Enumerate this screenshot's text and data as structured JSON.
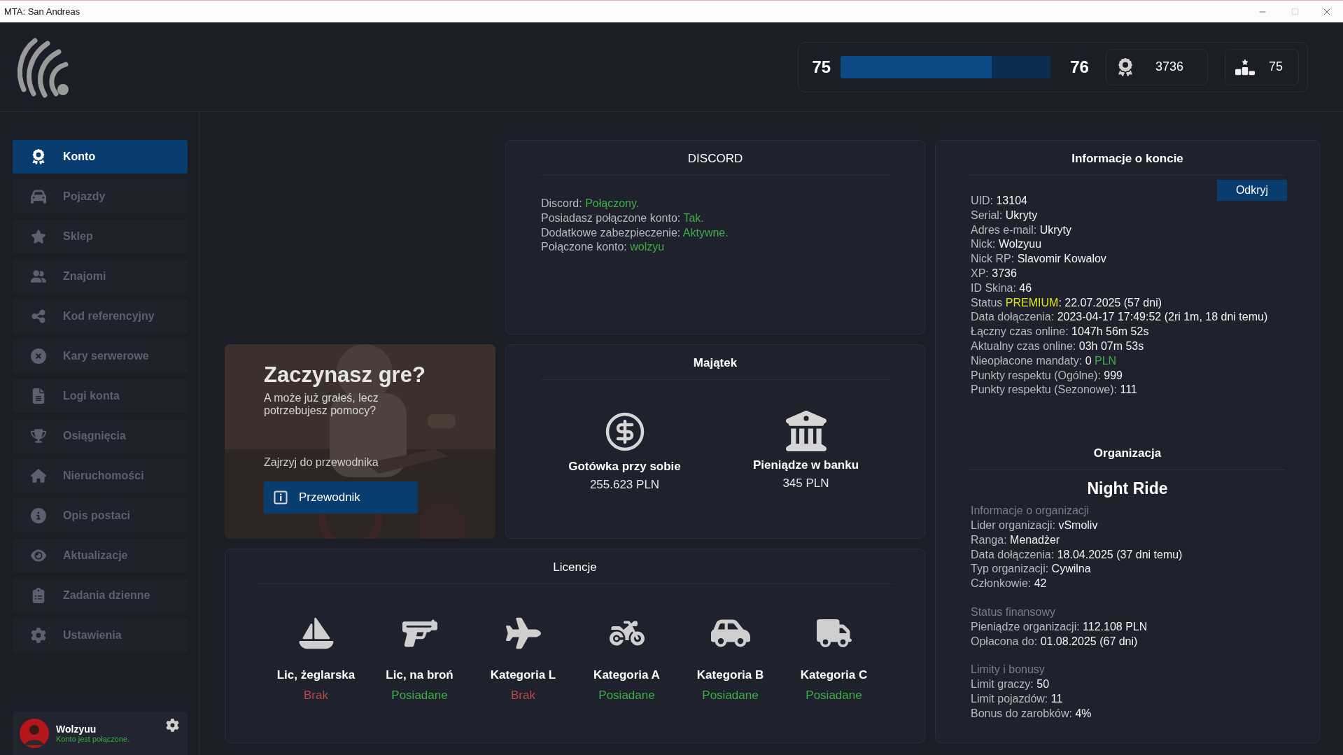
{
  "window": {
    "title": "MTA: San Andreas"
  },
  "stats": {
    "level": "75",
    "next_level": "76",
    "progress": {
      "level": 0.72
    },
    "xp": "3736",
    "rank": "75"
  },
  "sidebar": {
    "items": [
      {
        "label": "Konto",
        "selected": true
      },
      {
        "label": "Pojazdy",
        "selected": false
      },
      {
        "label": "Sklep",
        "selected": false
      },
      {
        "label": "Znajomi",
        "selected": false
      },
      {
        "label": "Kod referencyjny",
        "selected": false
      },
      {
        "label": "Kary serwerowe",
        "selected": false
      },
      {
        "label": "Logi konta",
        "selected": false
      },
      {
        "label": "Osiągnięcia",
        "selected": false
      },
      {
        "label": "Nieruchomości",
        "selected": false
      },
      {
        "label": "Opis postaci",
        "selected": false
      },
      {
        "label": "Aktualizacje",
        "selected": false
      },
      {
        "label": "Zadania dzienne",
        "selected": false
      },
      {
        "label": "Ustawienia",
        "selected": false
      }
    ],
    "user": {
      "name": "Wolzyuu",
      "status": "Konto jest połączone."
    }
  },
  "guide": {
    "title": "Zaczynasz gre?",
    "subtitle": "A może już grałeś, lecz potrzebujesz pomocy?",
    "hint": "Zajrzyj do przewodnika",
    "button": "Przewodnik"
  },
  "discord": {
    "title": "DISCORD",
    "lines": [
      [
        {
          "text": "Discord: ",
          "color": "#b8b9bd"
        },
        {
          "text": "Połączony.",
          "color": "#3fae4a"
        }
      ],
      [
        {
          "text": "Posiadasz połączone konto: ",
          "color": "#b8b9bd"
        },
        {
          "text": "Tak.",
          "color": "#3fae4a"
        }
      ],
      [
        {
          "text": "Dodatkowe zabezpieczenie: ",
          "color": "#b8b9bd"
        },
        {
          "text": "Aktywne.",
          "color": "#3fae4a"
        }
      ],
      [
        {
          "text": "Połączone konto: ",
          "color": "#b8b9bd"
        },
        {
          "text": "wolzyu",
          "color": "#3fae4a"
        }
      ]
    ]
  },
  "assets": {
    "title": "Majątek",
    "items": [
      {
        "label": "Gotówka przy sobie",
        "value": "255.623 PLN"
      },
      {
        "label": "Pieniądze w banku",
        "value": "345 PLN"
      }
    ]
  },
  "licenses": {
    "title": "Licencje",
    "items": [
      {
        "label": "Lic, żeglarska",
        "status": "Brak",
        "owned": false
      },
      {
        "label": "Lic, na broń",
        "status": "Posiadane",
        "owned": true
      },
      {
        "label": "Kategoria L",
        "status": "Brak",
        "owned": false
      },
      {
        "label": "Kategoria A",
        "status": "Posiadane",
        "owned": true
      },
      {
        "label": "Kategoria B",
        "status": "Posiadane",
        "owned": true
      },
      {
        "label": "Kategoria C",
        "status": "Posiadane",
        "owned": true
      }
    ]
  },
  "account": {
    "title": "Informacje o koncie",
    "reveal_button": "Odkryj",
    "lines": [
      [
        {
          "text": "UID: ",
          "color": "#b8b9bd"
        },
        {
          "text": "13104",
          "color": "#f4f4f4"
        }
      ],
      [
        {
          "text": "Serial: ",
          "color": "#b8b9bd"
        },
        {
          "text": "Ukryty",
          "color": "#f4f4f4"
        }
      ],
      [
        {
          "text": "Adres e-mail: ",
          "color": "#b8b9bd"
        },
        {
          "text": "Ukryty",
          "color": "#f4f4f4"
        }
      ],
      [
        {
          "text": "Nick: ",
          "color": "#b8b9bd"
        },
        {
          "text": "Wolzyuu",
          "color": "#f4f4f4"
        }
      ],
      [
        {
          "text": "Nick RP: ",
          "color": "#b8b9bd"
        },
        {
          "text": "Slavomir Kowalov",
          "color": "#f4f4f4"
        }
      ],
      [
        {
          "text": "XP: ",
          "color": "#b8b9bd"
        },
        {
          "text": "3736",
          "color": "#f4f4f4"
        }
      ],
      [
        {
          "text": "ID Skina: ",
          "color": "#b8b9bd"
        },
        {
          "text": "46",
          "color": "#f4f4f4"
        }
      ],
      [
        {
          "text": "Status ",
          "color": "#b8b9bd"
        },
        {
          "text": "PREMIUM",
          "color": "#e2e21c"
        },
        {
          "text": ": 22.07.2025 (57 dni)",
          "color": "#f4f4f4"
        }
      ],
      [
        {
          "text": "Data dołączenia: ",
          "color": "#b8b9bd"
        },
        {
          "text": "2023-04-17 17:49:52 (2ri 1m, 18 dni temu)",
          "color": "#f4f4f4"
        }
      ],
      [
        {
          "text": "Łączny czas online: ",
          "color": "#b8b9bd"
        },
        {
          "text": "1047h 56m 52s",
          "color": "#f4f4f4"
        }
      ],
      [
        {
          "text": "Aktualny czas online: ",
          "color": "#b8b9bd"
        },
        {
          "text": "03h 07m 53s",
          "color": "#f4f4f4"
        }
      ],
      [
        {
          "text": "Nieopłacone mandaty: ",
          "color": "#b8b9bd"
        },
        {
          "text": "0 ",
          "color": "#f4f4f4"
        },
        {
          "text": "PLN",
          "color": "#3fae4a"
        }
      ],
      [
        {
          "text": "Punkty respektu (Ogólne): ",
          "color": "#b8b9bd"
        },
        {
          "text": "999",
          "color": "#f4f4f4"
        }
      ],
      [
        {
          "text": "Punkty respektu (Sezonowe): ",
          "color": "#b8b9bd"
        },
        {
          "text": "111",
          "color": "#f4f4f4"
        }
      ]
    ]
  },
  "organization": {
    "title": "Organizacja",
    "name": "Night Ride",
    "groups": [
      {
        "heading": "Informacje o organizacji",
        "lines": [
          [
            {
              "text": "Lider organizacji: ",
              "color": "#b8b9bd"
            },
            {
              "text": "vSmoliv",
              "color": "#f4f4f4"
            }
          ],
          [
            {
              "text": "Ranga: ",
              "color": "#b8b9bd"
            },
            {
              "text": "Menadżer",
              "color": "#f4f4f4"
            }
          ],
          [
            {
              "text": "Data dołączenia: ",
              "color": "#b8b9bd"
            },
            {
              "text": "18.04.2025 (37 dni temu)",
              "color": "#f4f4f4"
            }
          ],
          [
            {
              "text": "Typ organizacji: ",
              "color": "#b8b9bd"
            },
            {
              "text": "Cywilna",
              "color": "#f4f4f4"
            }
          ],
          [
            {
              "text": "Członkowie: ",
              "color": "#b8b9bd"
            },
            {
              "text": "42",
              "color": "#f4f4f4"
            }
          ]
        ]
      },
      {
        "heading": "Status finansowy",
        "lines": [
          [
            {
              "text": "Pieniądze organizacji: ",
              "color": "#b8b9bd"
            },
            {
              "text": "112.108 PLN",
              "color": "#f4f4f4"
            }
          ],
          [
            {
              "text": "Opłacona do: ",
              "color": "#b8b9bd"
            },
            {
              "text": "01.08.2025 (67 dni)",
              "color": "#f4f4f4"
            }
          ]
        ]
      },
      {
        "heading": "Limity i bonusy",
        "lines": [
          [
            {
              "text": "Limit graczy: ",
              "color": "#b8b9bd"
            },
            {
              "text": "50",
              "color": "#f4f4f4"
            }
          ],
          [
            {
              "text": "Limit pojazdów: ",
              "color": "#b8b9bd"
            },
            {
              "text": "11",
              "color": "#f4f4f4"
            }
          ],
          [
            {
              "text": "Bonus do zarobków: ",
              "color": "#b8b9bd"
            },
            {
              "text": "4%",
              "color": "#f4f4f4"
            }
          ]
        ]
      }
    ]
  }
}
